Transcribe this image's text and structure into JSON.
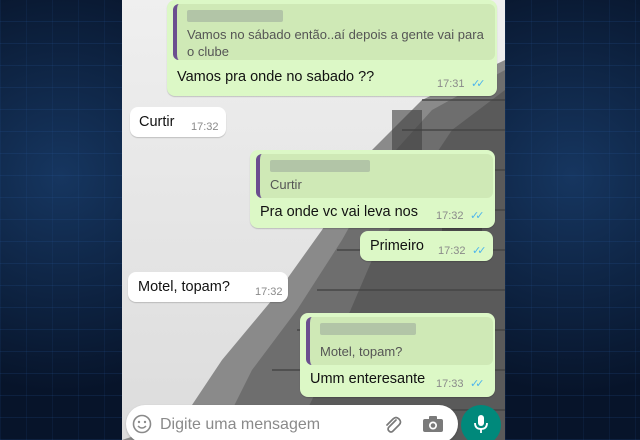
{
  "chat": {
    "messages": [
      {
        "quote": "Vamos no sábado então..aí depois a gente vai para o clube",
        "text": "Vamos pra onde no sabado ??",
        "time": "17:31"
      },
      {
        "text": "Curtir",
        "time": "17:32"
      },
      {
        "quote": "Curtir",
        "text": "Pra  onde vc vai leva nos",
        "time": "17:32"
      },
      {
        "text": "Primeiro",
        "time": "17:32"
      },
      {
        "text": "Motel,  topam?",
        "time": "17:32"
      },
      {
        "quote": "Motel,  topam?",
        "text": "Umm enteresante",
        "time": "17:33"
      }
    ]
  },
  "input": {
    "placeholder": "Digite uma mensagem"
  },
  "icons": {
    "emoji": "emoji-icon",
    "attach": "paperclip-icon",
    "camera": "camera-icon",
    "mic": "microphone-icon",
    "read": "double-check-icon"
  },
  "colors": {
    "outgoing_bubble": "#dcf8c6",
    "incoming_bubble": "#ffffff",
    "read_ticks": "#4fb6ec",
    "mic_button": "#00897b"
  }
}
